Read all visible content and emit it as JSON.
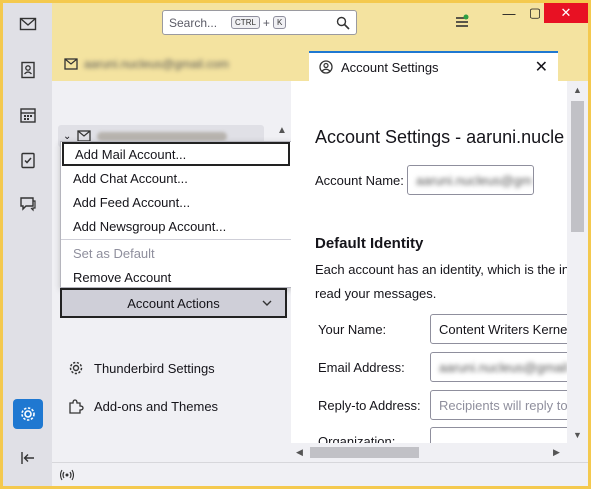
{
  "search": {
    "placeholder": "Search...",
    "key1": "CTRL",
    "plus": "+",
    "key2": "K"
  },
  "window": {
    "minimize": "—",
    "maximize": "▢",
    "close": "✕"
  },
  "tabs": {
    "inactive_label": "aaruni.nucleus@gmail.com",
    "active_label": "Account Settings",
    "close": "✕"
  },
  "account_menu": {
    "items": [
      {
        "label": "Add Mail Account...",
        "state": "focused"
      },
      {
        "label": "Add Chat Account...",
        "state": "normal"
      },
      {
        "label": "Add Feed Account...",
        "state": "normal"
      },
      {
        "label": "Add Newsgroup Account...",
        "state": "normal"
      },
      {
        "label": "Set as Default",
        "state": "disabled"
      },
      {
        "label": "Remove Account",
        "state": "normal"
      }
    ],
    "actions_button": "Account Actions"
  },
  "nav": {
    "settings": "Thunderbird Settings",
    "addons": "Add-ons and Themes"
  },
  "main": {
    "title": "Account Settings - aaruni.nucle",
    "account_name_label": "Account Name:",
    "account_name_value": "aaruni.nucleus@gm",
    "default_identity": "Default Identity",
    "identity_desc_1": "Each account has an identity, which is the in",
    "identity_desc_2": "read your messages.",
    "your_name_label": "Your Name:",
    "your_name_value": "Content Writers Kerne",
    "email_label": "Email Address:",
    "email_value": "aaruni.nucleus@gmail",
    "replyto_label": "Reply-to Address:",
    "replyto_placeholder": "Recipients will reply to",
    "org_label": "Organization:"
  },
  "colors": {
    "accent": "#1f78d1",
    "title_bar": "#f4e3a0",
    "close_red": "#e81123"
  }
}
